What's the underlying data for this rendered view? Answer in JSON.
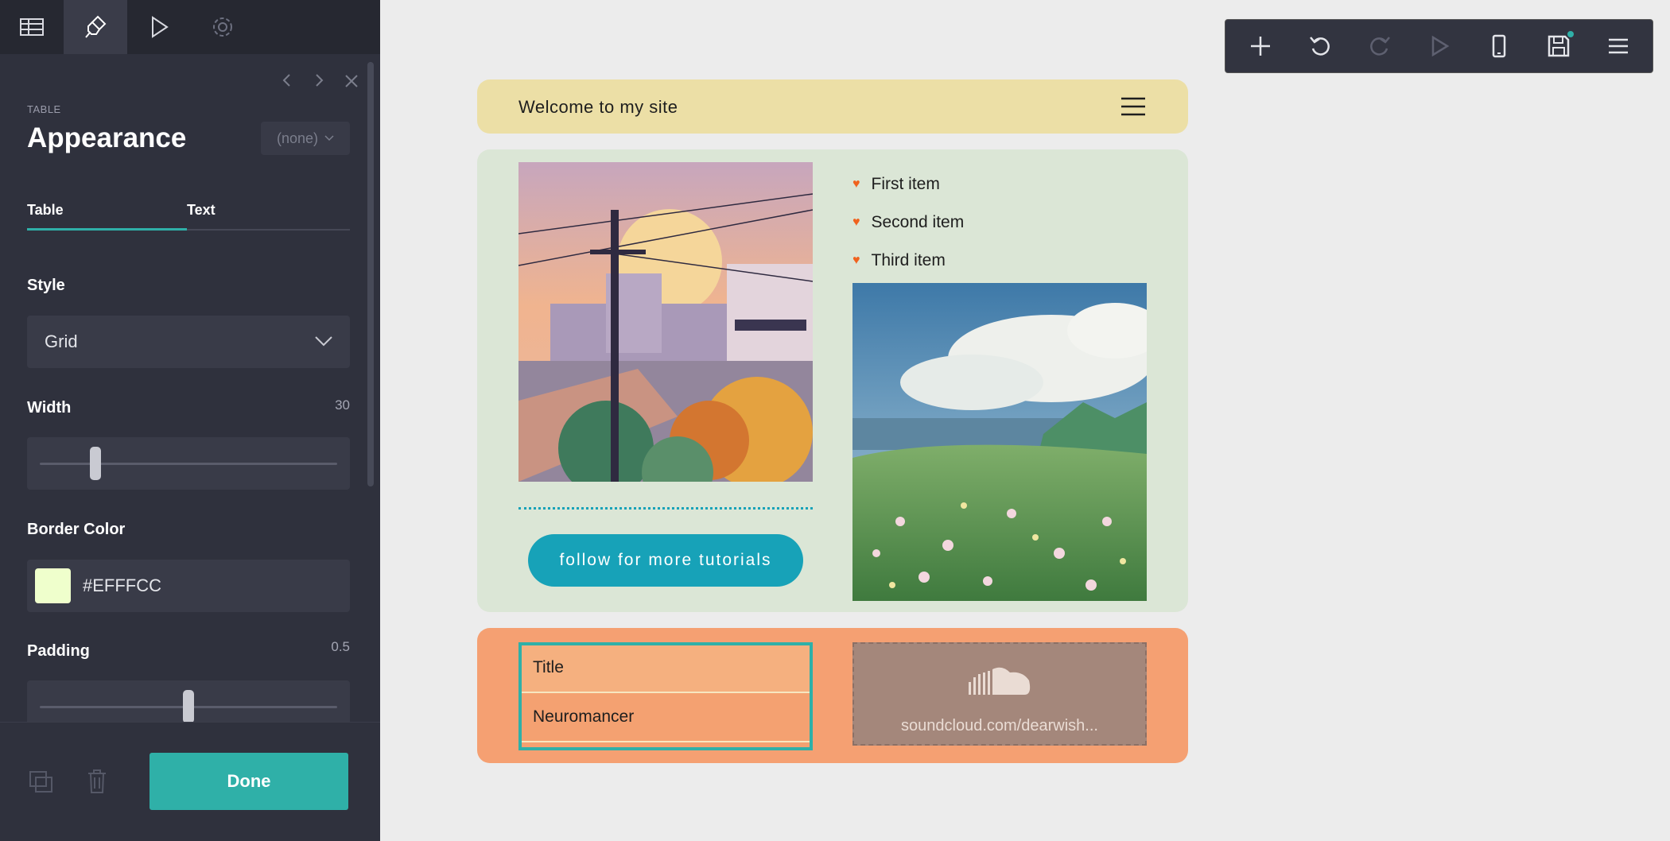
{
  "panel": {
    "nav_tabs": [
      {
        "icon": "table-icon"
      },
      {
        "icon": "paint-brush-icon"
      },
      {
        "icon": "play-icon"
      },
      {
        "icon": "gear-icon"
      }
    ],
    "eyebrow": "TABLE",
    "title": "Appearance",
    "preset": "(none)",
    "subtabs": [
      {
        "label": "Table",
        "active": true
      },
      {
        "label": "Text",
        "active": false
      }
    ],
    "style": {
      "label": "Style",
      "value": "Grid"
    },
    "width": {
      "label": "Width",
      "value": "30",
      "fraction": 0.2
    },
    "border_color": {
      "label": "Border Color",
      "value": "#EFFFCC"
    },
    "padding": {
      "label": "Padding",
      "value": "0.5",
      "fraction": 0.5
    },
    "done_label": "Done",
    "accent_color": "#2fb0a8"
  },
  "toolbar": {
    "buttons": [
      "plus-icon",
      "undo-icon",
      "redo-icon",
      "preview-icon",
      "mobile-icon",
      "save-icon",
      "menu-icon"
    ]
  },
  "site": {
    "header_title": "Welcome to my site",
    "list": [
      "First item",
      "Second item",
      "Third item"
    ],
    "cta": "follow for more tutorials",
    "table": {
      "rows": [
        "Title",
        "Neuromancer"
      ]
    },
    "soundcloud_url": "soundcloud.com/dearwish..."
  }
}
